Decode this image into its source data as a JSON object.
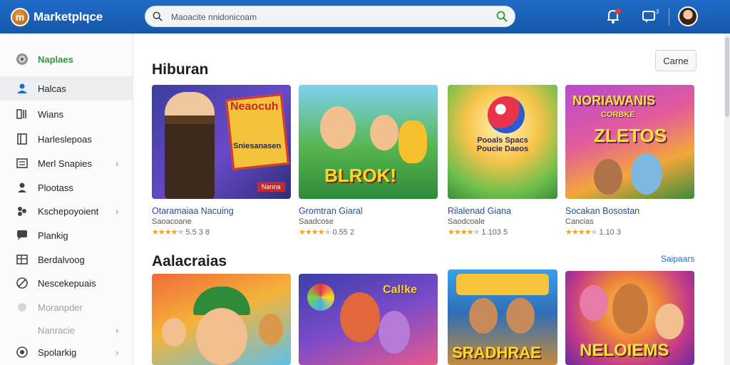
{
  "header": {
    "app_name": "Marketplqce",
    "logo_letter": "m",
    "search_placeholder": "Maoacite nnidonicoam",
    "notification_badge": "",
    "message_badge": "3"
  },
  "sidebar": {
    "items": [
      {
        "label": "Naplaes",
        "icon": "compass-icon",
        "style": "green"
      },
      {
        "label": "Halcas",
        "icon": "user-icon",
        "style": "active"
      },
      {
        "label": "Wians",
        "icon": "grid-icon",
        "style": ""
      },
      {
        "label": "Harleslepoas",
        "icon": "book-icon",
        "style": ""
      },
      {
        "label": "Merl Snapies",
        "icon": "list-icon",
        "style": "",
        "chevron": "›"
      },
      {
        "label": "Plootass",
        "icon": "person-icon",
        "style": ""
      },
      {
        "label": "Kschepoyoient",
        "icon": "puzzle-icon",
        "style": "",
        "chevron": "›"
      },
      {
        "label": "Plankig",
        "icon": "chat-icon",
        "style": ""
      },
      {
        "label": "Berdalvoog",
        "icon": "table-icon",
        "style": ""
      },
      {
        "label": "Nescekepuais",
        "icon": "globe-icon",
        "style": ""
      },
      {
        "label": "Moranpder",
        "icon": "circle-icon",
        "style": "dim"
      },
      {
        "label": "Nanracie",
        "icon": "",
        "style": "dim",
        "chevron": "›"
      },
      {
        "label": "Spolarkig",
        "icon": "badge-icon",
        "style": "",
        "chevron": "›"
      }
    ]
  },
  "main": {
    "section1_title": "Hiburan",
    "section1_button": "Carne",
    "section2_title": "Aalacraias",
    "section2_link": "Saipaars",
    "cards_row1": [
      {
        "title": "Otaramaiaa Nacuing",
        "sub": "Saoacoane",
        "rating": "5.5 3 8",
        "stars": 4,
        "thumb_text": "Neaocuh",
        "thumb_sub": "Sniesanasen",
        "thumb_tag": "Nanna"
      },
      {
        "title": "Gromtran Giaral",
        "sub": "Saadcose",
        "rating": "0.55 2",
        "stars": 4,
        "thumb_text": "BLROK!",
        "thumb_sub": "",
        "thumb_tag": ""
      },
      {
        "title": "Rilalenad Giana",
        "sub": "Saodcoale",
        "rating": "1.103 5",
        "stars": 4,
        "thumb_text": "Poucie Daeos",
        "thumb_sub": "Pooals  Spacs",
        "thumb_tag": ""
      },
      {
        "title": "Socakan Bosostan",
        "sub": "Cancias",
        "rating": "1.10 3",
        "stars": 4,
        "thumb_text": "ZLETOS",
        "thumb_sub": "NORIAWANIS",
        "thumb_tag": "CORBKE"
      }
    ],
    "cards_row2": [
      {
        "thumb_text": ""
      },
      {
        "thumb_text": "Cal!ke"
      },
      {
        "thumb_text": "SRADHRAE"
      },
      {
        "thumb_text": "NELOIEMS"
      }
    ]
  },
  "colors": {
    "topbar": "#1f6bc7",
    "accent_green": "#2e9a3a",
    "link_blue": "#1f4e9b",
    "star": "#f4a21b"
  }
}
